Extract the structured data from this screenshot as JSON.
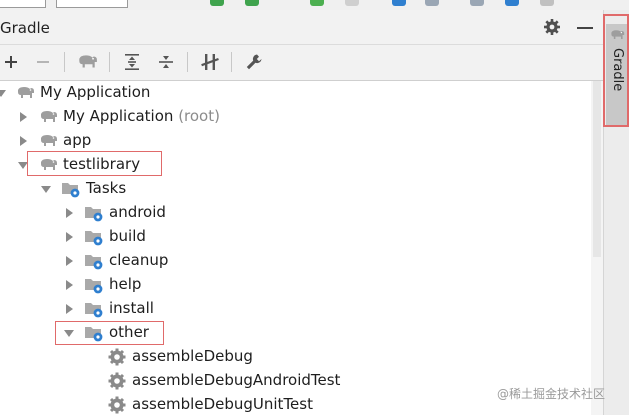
{
  "panel": {
    "title": "Gradle"
  },
  "sidebar": {
    "tab_label": "Gradle"
  },
  "toolbar": {
    "buttons": [
      "add-icon",
      "remove-icon",
      "elephant-icon",
      "expand-all-icon",
      "collapse-all-icon",
      "toggle-offline-icon",
      "wrench-icon"
    ]
  },
  "tree": {
    "root": "My Application",
    "project_root": "My Application",
    "project_root_suffix": "(root)",
    "app": "app",
    "testlibrary": "testlibrary",
    "tasks": "Tasks",
    "groups": [
      "android",
      "build",
      "cleanup",
      "help",
      "install",
      "other"
    ],
    "other_tasks": [
      "assembleDebug",
      "assembleDebugAndroidTest",
      "assembleDebugUnitTest"
    ]
  },
  "colors": {
    "highlight": "#e06a6a",
    "gear": "#2f7fcf",
    "elephant": "#9e9e9e"
  },
  "watermark": "@稀土掘金技术社区"
}
